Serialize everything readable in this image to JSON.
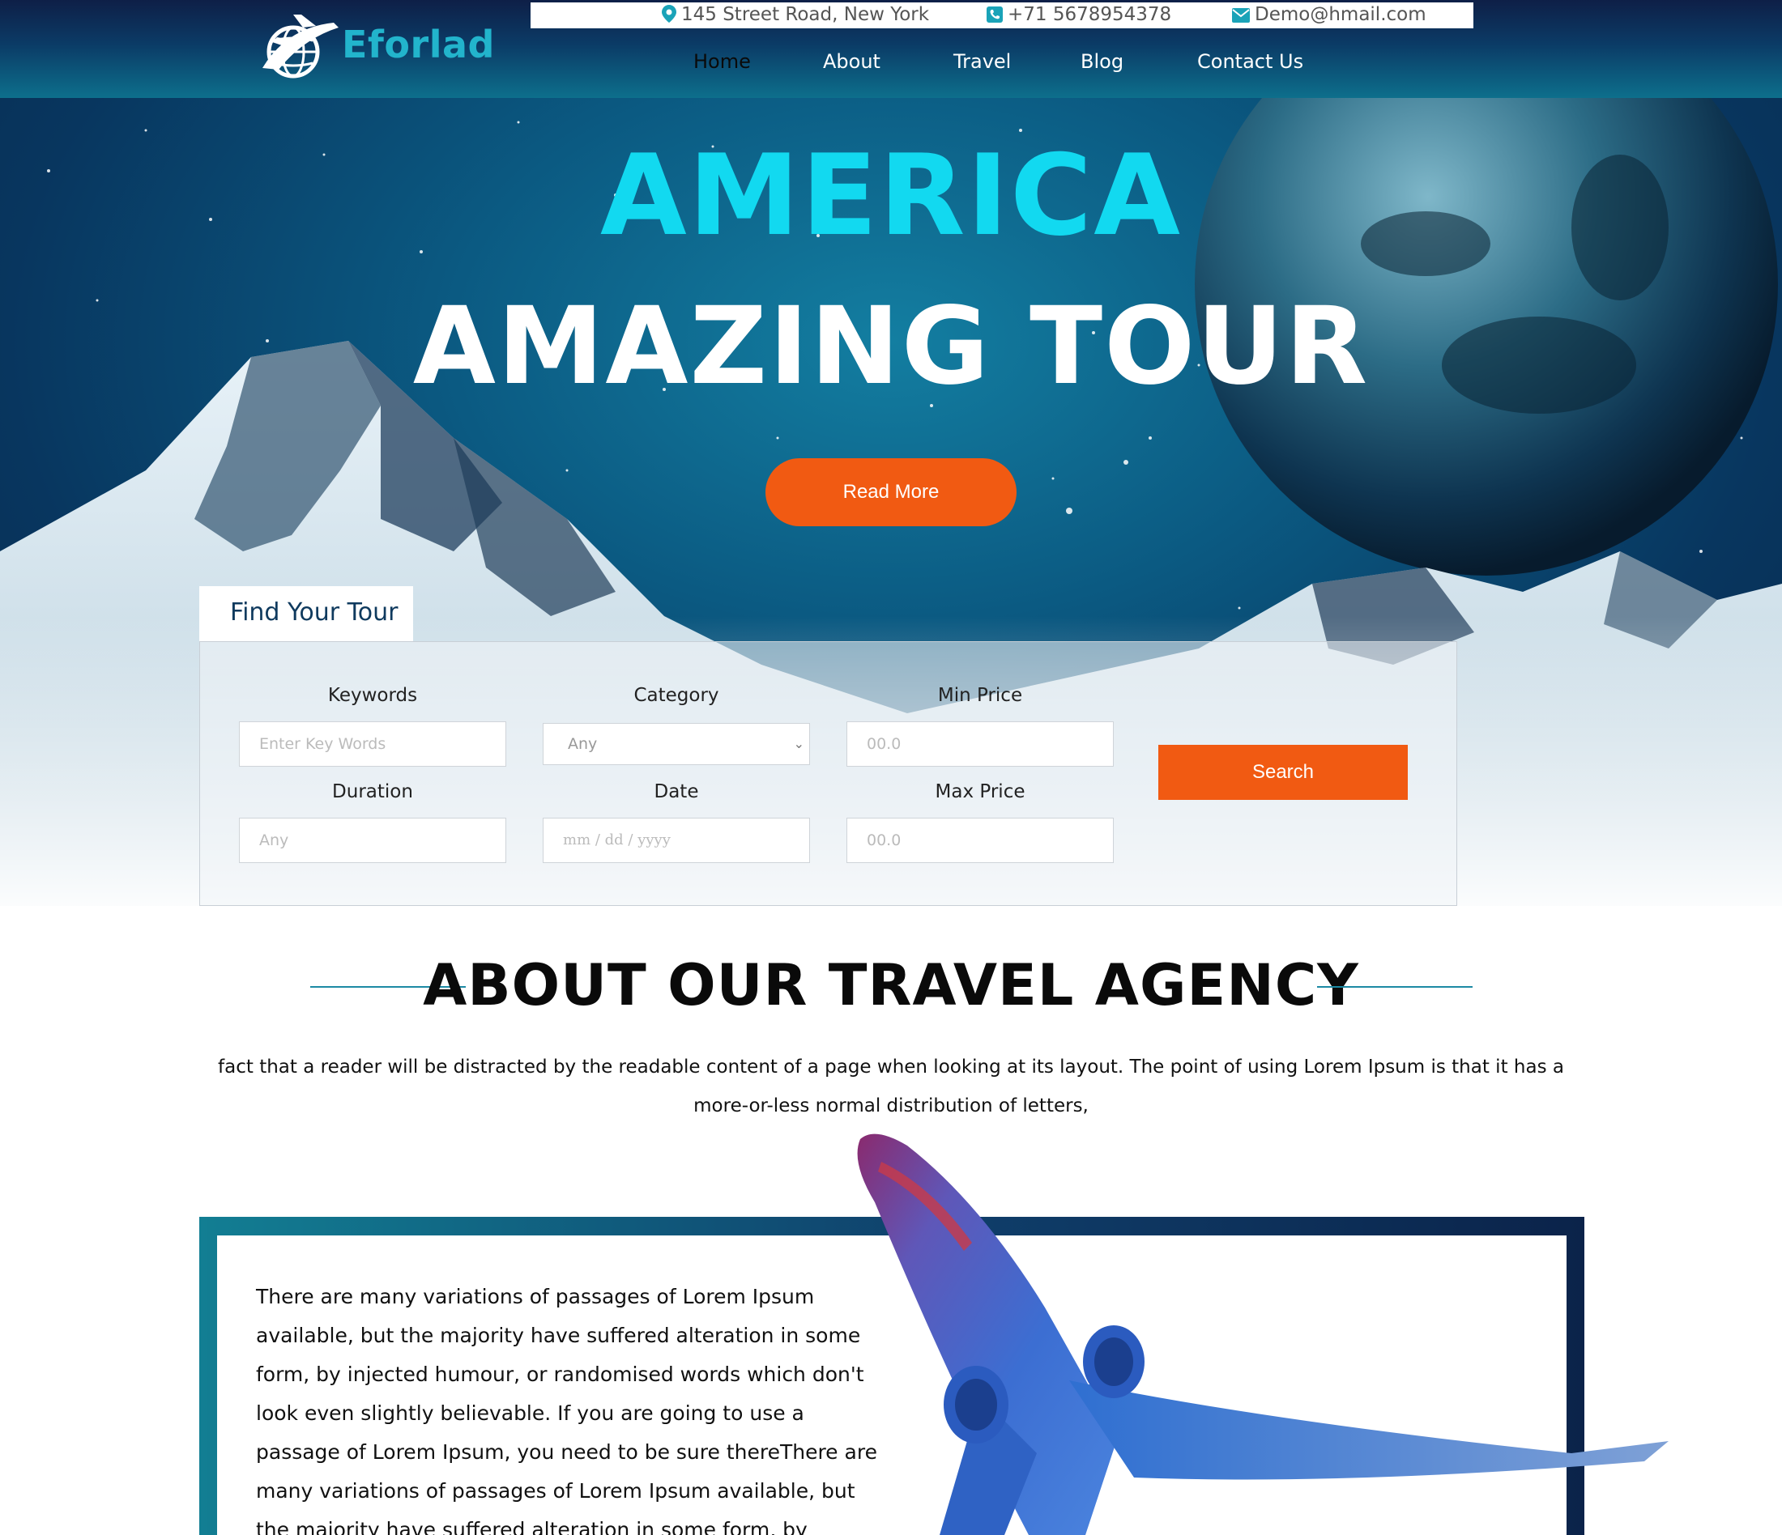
{
  "header": {
    "brand": "Eforlad",
    "contact": {
      "address": "145 Street Road, New York",
      "phone": "+71 5678954378",
      "email": "Demo@hmail.com"
    },
    "nav": [
      {
        "label": "Home",
        "active": true
      },
      {
        "label": "About",
        "active": false
      },
      {
        "label": "Travel",
        "active": false
      },
      {
        "label": "Blog",
        "active": false
      },
      {
        "label": "Contact Us",
        "active": false
      }
    ]
  },
  "hero": {
    "title_line1": "AMERICA",
    "title_line2": "AMAZING TOUR",
    "cta_label": "Read More"
  },
  "search": {
    "tab_label": "Find Your Tour",
    "fields": {
      "keywords": {
        "label": "Keywords",
        "placeholder": "Enter Key Words"
      },
      "category": {
        "label": "Category",
        "value": "Any"
      },
      "min_price": {
        "label": "Min Price",
        "placeholder": "00.0"
      },
      "duration": {
        "label": "Duration",
        "placeholder": "Any"
      },
      "date": {
        "label": "Date",
        "placeholder": "mm / dd / yyyy"
      },
      "max_price": {
        "label": "Max Price",
        "placeholder": "00.0"
      }
    },
    "button_label": "Search"
  },
  "about": {
    "title": "ABOUT OUR TRAVEL AGENCY",
    "intro": "fact that a reader will be distracted by the readable content of a page when looking at its layout. The point of using Lorem Ipsum is that it has a more-or-less normal distribution of letters,",
    "body": "There are many variations of passages of Lorem Ipsum available, but the majority have suffered alteration in some form, by injected humour, or randomised words which don't look even slightly believable. If you are going to use a passage of Lorem Ipsum, you need to be sure thereThere are many variations of passages of Lorem Ipsum available, but the majority have suffered alteration in some form, by injected humour, or randomised words which don't"
  },
  "colors": {
    "accent_orange": "#f15a12",
    "brand_cyan": "#22b4cc",
    "hero_title_cyan": "#12d9f0",
    "navy": "#0e1f47"
  },
  "icons": {
    "address": "map-pin-icon",
    "phone": "phone-icon",
    "email": "envelope-icon",
    "select": "chevron-down-icon"
  }
}
